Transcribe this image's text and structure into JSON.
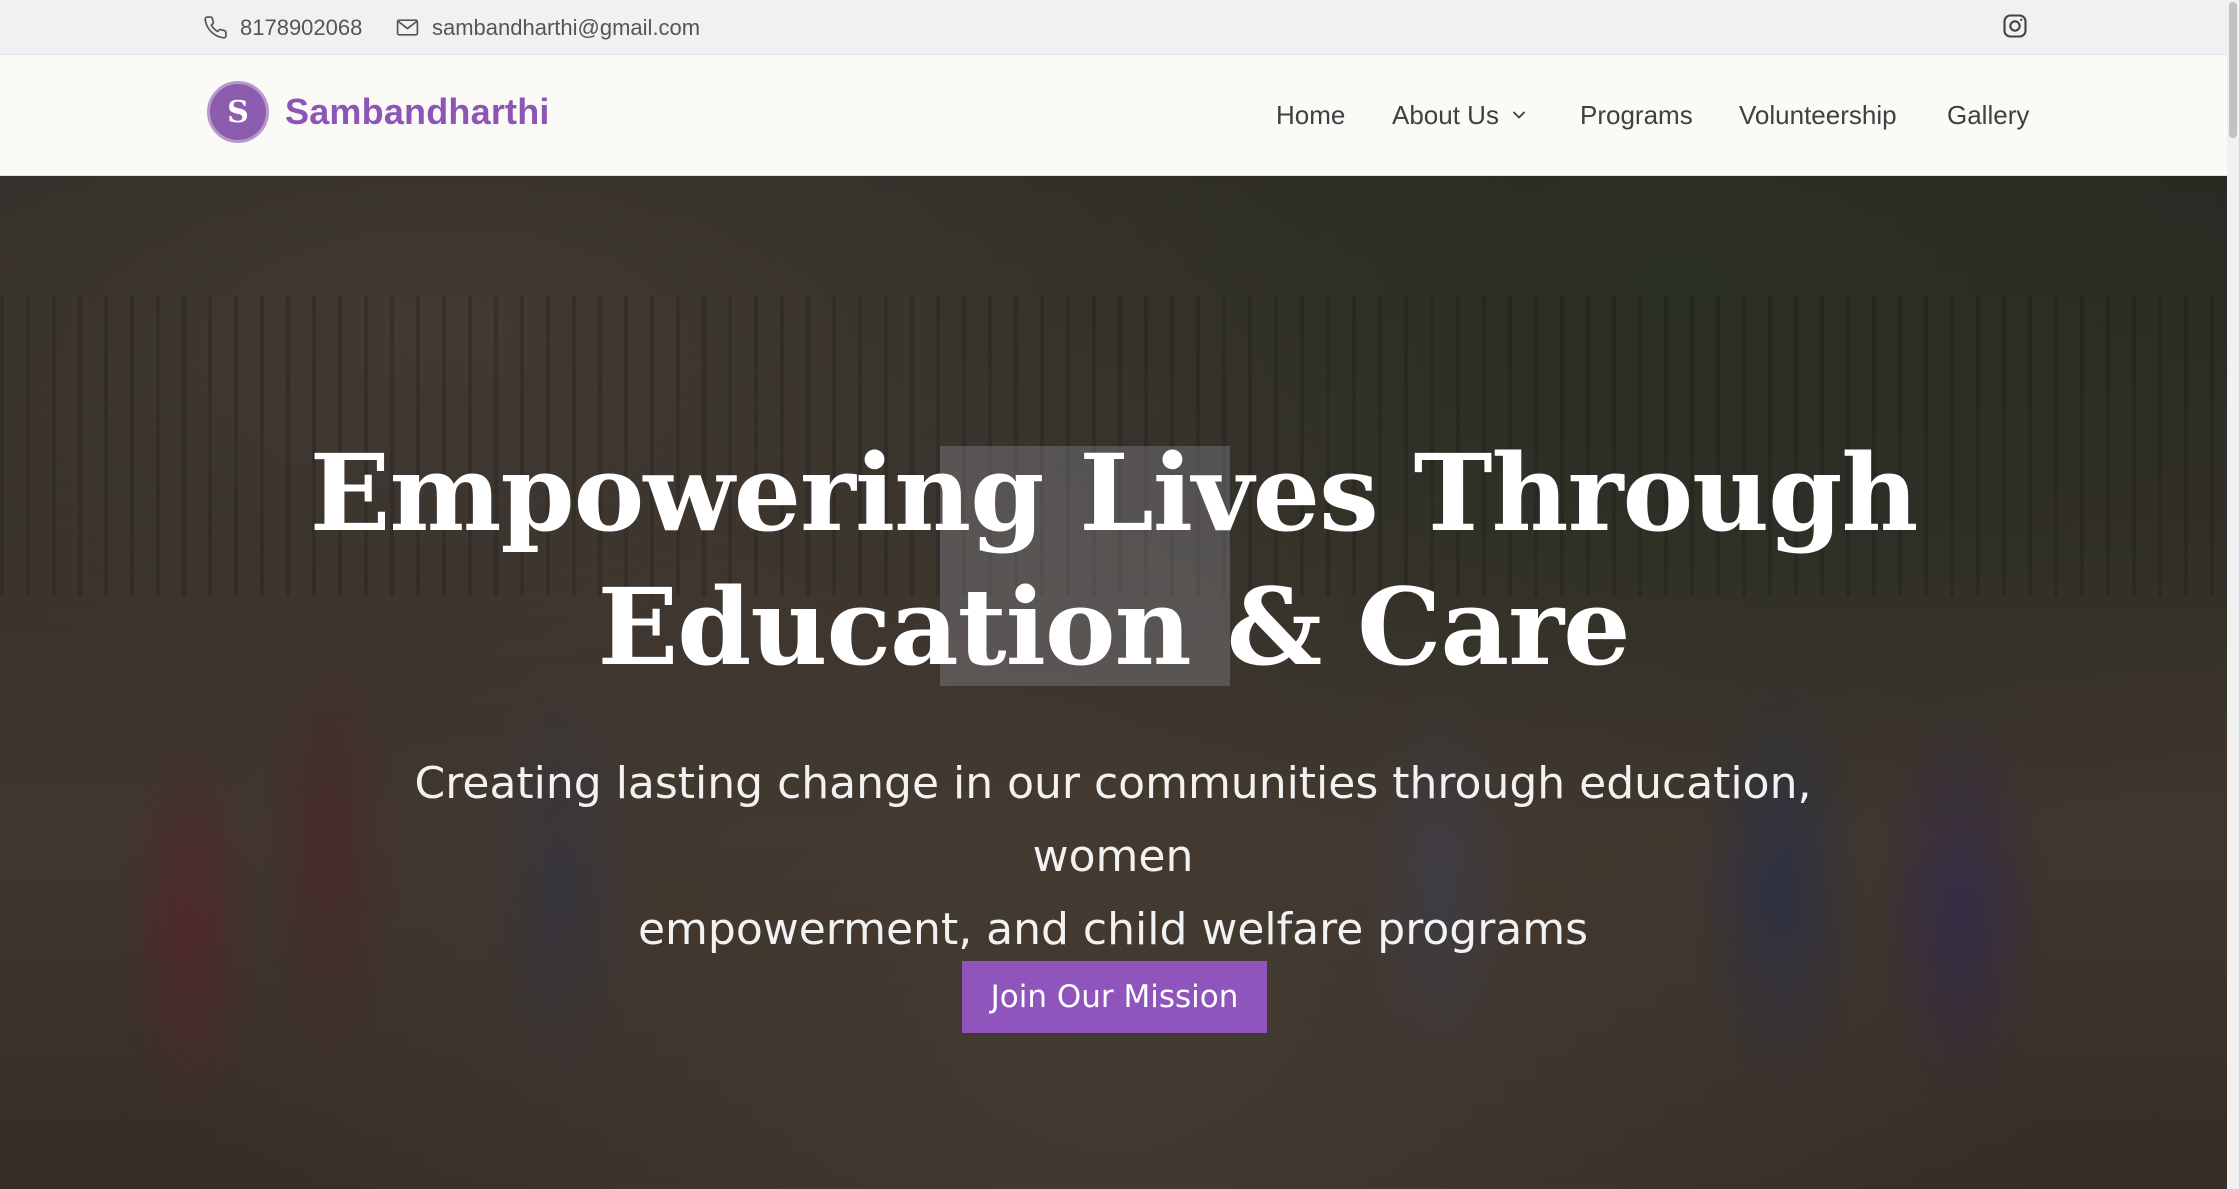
{
  "topbar": {
    "phone": "8178902068",
    "email": "sambandharthi@gmail.com",
    "phone_icon": "phone-icon",
    "email_icon": "mail-icon",
    "social_icon": "instagram-icon"
  },
  "nav": {
    "brand": "Sambandharthi",
    "logo_letter": "S",
    "items": [
      {
        "label": "Home"
      },
      {
        "label": "About Us",
        "icon": "chevron-down-icon"
      },
      {
        "label": "Programs"
      },
      {
        "label": "Volunteership"
      },
      {
        "label": "Gallery"
      }
    ]
  },
  "hero": {
    "title_line1": "Empowering Lives Through",
    "title_line2": "Education & Care",
    "subtitle_line1": "Creating lasting change in our communities through education, women",
    "subtitle_line2": "empowerment, and child welfare programs",
    "cta": "Join Our Mission"
  },
  "colors": {
    "brand": "#8c56b6",
    "button": "#8f55bd",
    "topbar_bg": "#f3f0f3",
    "navbar_bg": "#fbfaf7"
  }
}
